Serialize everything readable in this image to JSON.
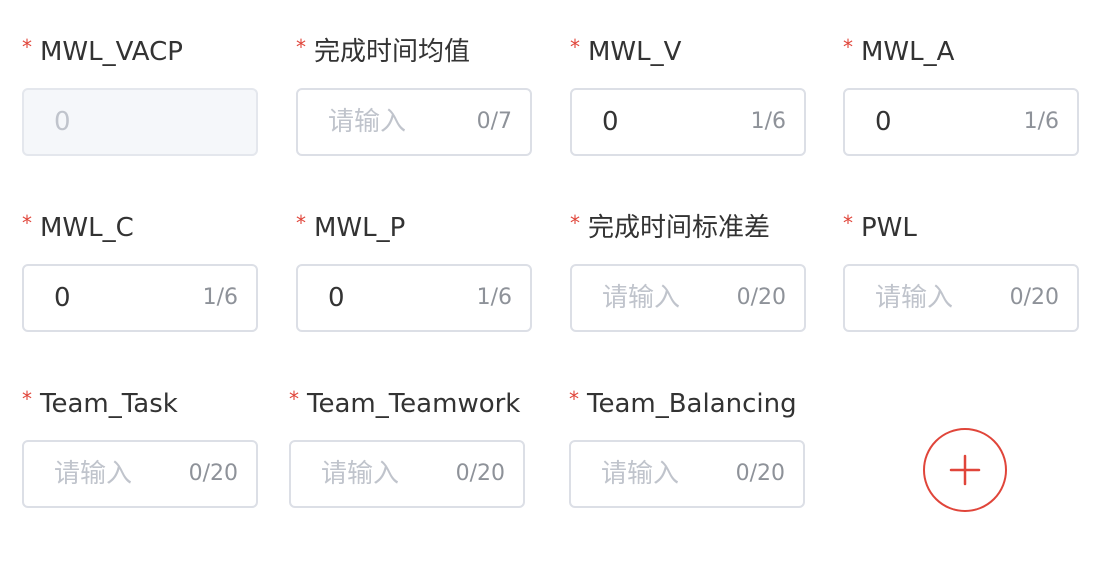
{
  "colors": {
    "required": "#e0453a",
    "add_button": "#e0453a",
    "border": "#dcdfe6",
    "placeholder": "#c0c4cc"
  },
  "fields": [
    {
      "label": "MWL_VACP",
      "value": "0",
      "counter": "",
      "disabled": true
    },
    {
      "label": "完成时间均值",
      "placeholder": "请输入",
      "counter": "0/7"
    },
    {
      "label": "MWL_V",
      "value": "0",
      "counter": "1/6"
    },
    {
      "label": "MWL_A",
      "value": "0",
      "counter": "1/6"
    },
    {
      "label": "MWL_C",
      "value": "0",
      "counter": "1/6"
    },
    {
      "label": "MWL_P",
      "value": "0",
      "counter": "1/6"
    },
    {
      "label": "完成时间标准差",
      "placeholder": "请输入",
      "counter": "0/20"
    },
    {
      "label": "PWL",
      "placeholder": "请输入",
      "counter": "0/20"
    },
    {
      "label": "Team_Task",
      "placeholder": "请输入",
      "counter": "0/20"
    },
    {
      "label": "Team_Teamwork",
      "placeholder": "请输入",
      "counter": "0/20"
    },
    {
      "label": "Team_Balancing",
      "placeholder": "请输入",
      "counter": "0/20"
    }
  ],
  "required_mark": "*",
  "add_button": {
    "icon": "plus-icon"
  }
}
